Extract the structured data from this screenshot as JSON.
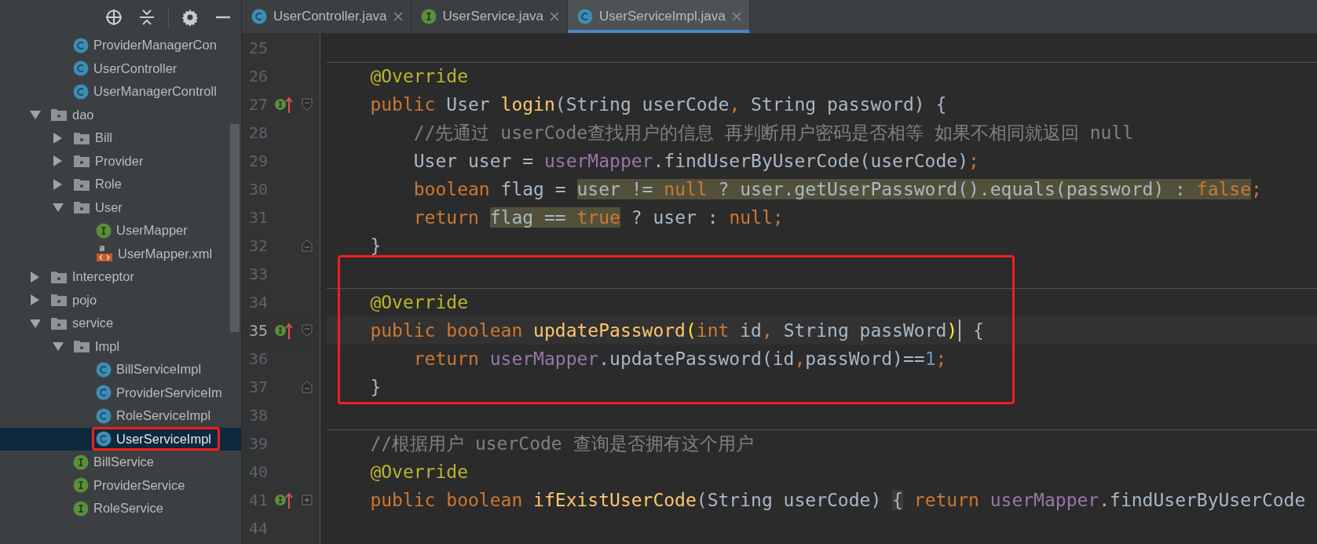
{
  "toolbar": {
    "buttons": [
      {
        "kind": "locate"
      },
      {
        "kind": "collapse"
      },
      {
        "kind": "settings"
      },
      {
        "kind": "hide"
      }
    ]
  },
  "tabs": [
    {
      "label": "UserController.java",
      "kind": "class",
      "selected": false
    },
    {
      "label": "UserService.java",
      "kind": "interface",
      "selected": false
    },
    {
      "label": "UserServiceImpl.java",
      "kind": "class",
      "selected": true
    }
  ],
  "sidebar": {
    "items": [
      {
        "children": [
          {
            "label": "ProviderManagerCon",
            "kind": "class"
          },
          {
            "label": "UserController",
            "kind": "class"
          },
          {
            "label": "UserManagerControll",
            "kind": "class"
          }
        ]
      },
      {
        "label": "dao",
        "kind": "folder",
        "expanded": true,
        "children": [
          {
            "label": "Bill",
            "kind": "folder",
            "expanded": false
          },
          {
            "label": "Provider",
            "kind": "folder",
            "expanded": false
          },
          {
            "label": "Role",
            "kind": "folder",
            "expanded": false
          },
          {
            "label": "User",
            "kind": "folder",
            "expanded": true,
            "children": [
              {
                "label": "UserMapper",
                "kind": "interface"
              },
              {
                "label": "UserMapper.xml",
                "kind": "xml"
              }
            ]
          }
        ]
      },
      {
        "label": "Interceptor",
        "kind": "folder",
        "expanded": false
      },
      {
        "label": "pojo",
        "kind": "folder",
        "expanded": false
      },
      {
        "label": "service",
        "kind": "folder",
        "expanded": true,
        "children": [
          {
            "label": "Impl",
            "kind": "folder",
            "expanded": true,
            "children": [
              {
                "label": "BillServiceImpl",
                "kind": "class",
                "selected": false,
                "boxed": false
              },
              {
                "label": "ProviderServiceIm",
                "kind": "class",
                "selected": false,
                "boxed": false
              },
              {
                "label": "RoleServiceImpl",
                "kind": "class",
                "selected": false,
                "boxed": false
              },
              {
                "label": "UserServiceImpl",
                "kind": "class",
                "selected": true,
                "boxed": true
              }
            ]
          },
          {
            "label": "BillService",
            "kind": "interface"
          },
          {
            "label": "ProviderService",
            "kind": "interface"
          },
          {
            "label": "RoleService",
            "kind": "interface"
          }
        ]
      }
    ]
  },
  "editor": {
    "lines": [
      {
        "number": "25"
      },
      {
        "number": "26",
        "separator_above": true,
        "tokens": [
          {
            "text": "    @Override",
            "kind": "annotation"
          }
        ]
      },
      {
        "number": "27",
        "marker": true,
        "fold_start": true,
        "tokens": [
          {
            "text": "    public",
            "kind": "keyword"
          },
          {
            "text": " User ",
            "kind": "plain"
          },
          {
            "text": "login",
            "kind": "method"
          },
          {
            "text": "(String userCode",
            "kind": "plain"
          },
          {
            "text": ",",
            "kind": "keyword"
          },
          {
            "text": " String password) {",
            "kind": "plain"
          }
        ]
      },
      {
        "number": "28",
        "tokens": [
          {
            "text": "        //先通过 userCode查找用户的信息 再判断用户密码是否相等 如果不相同就返回 null",
            "kind": "comment"
          }
        ]
      },
      {
        "number": "29",
        "tokens": [
          {
            "text": "        User user = ",
            "kind": "plain"
          },
          {
            "text": "userMapper",
            "kind": "field"
          },
          {
            "text": ".findUserByUserCode(userCode)",
            "kind": "plain"
          },
          {
            "text": ";",
            "kind": "keyword"
          }
        ]
      },
      {
        "number": "30",
        "tokens": [
          {
            "text": "        boolean",
            "kind": "keyword"
          },
          {
            "text": " flag = ",
            "kind": "plain"
          },
          {
            "text": "user != ",
            "kind": "plain",
            "highlighted": true
          },
          {
            "text": "null",
            "kind": "keyword",
            "highlighted": true
          },
          {
            "text": " ? user.getUserPassword().equals(password) : ",
            "kind": "plain",
            "highlighted": true
          },
          {
            "text": "false",
            "kind": "keyword",
            "highlighted": true
          },
          {
            "text": ";",
            "kind": "keyword"
          }
        ]
      },
      {
        "number": "31",
        "tokens": [
          {
            "text": "        return ",
            "kind": "keyword"
          },
          {
            "text": "flag == ",
            "kind": "plain",
            "highlighted": true
          },
          {
            "text": "true",
            "kind": "keyword",
            "highlighted": true
          },
          {
            "text": " ? user : ",
            "kind": "plain"
          },
          {
            "text": "null;",
            "kind": "keyword"
          }
        ]
      },
      {
        "number": "32",
        "fold_end": true,
        "tokens": [
          {
            "text": "    }",
            "kind": "plain"
          }
        ]
      },
      {
        "number": "33",
        "boxed": true
      },
      {
        "number": "34",
        "boxed": true,
        "separator_above": true,
        "tokens": [
          {
            "text": "    @Override",
            "kind": "annotation"
          }
        ]
      },
      {
        "number": "35",
        "boxed": true,
        "current": true,
        "marker": true,
        "fold_start": true,
        "tokens": [
          {
            "text": "    public boolean ",
            "kind": "keyword"
          },
          {
            "text": "updatePassword",
            "kind": "method"
          },
          {
            "text": "(",
            "kind": "brace-match"
          },
          {
            "text": "int",
            "kind": "keyword"
          },
          {
            "text": " id",
            "kind": "plain"
          },
          {
            "text": ",",
            "kind": "keyword"
          },
          {
            "text": " String passWord",
            "kind": "plain"
          },
          {
            "text": ")",
            "kind": "brace-match"
          },
          {
            "kind": "caret"
          },
          {
            "text": " {",
            "kind": "plain"
          }
        ]
      },
      {
        "number": "36",
        "boxed": true,
        "tokens": [
          {
            "text": "        return ",
            "kind": "keyword"
          },
          {
            "text": "userMapper",
            "kind": "field"
          },
          {
            "text": ".updatePassword(id",
            "kind": "plain"
          },
          {
            "text": ",",
            "kind": "keyword"
          },
          {
            "text": "passWord)==",
            "kind": "plain"
          },
          {
            "text": "1",
            "kind": "number"
          },
          {
            "text": ";",
            "kind": "keyword"
          }
        ]
      },
      {
        "number": "37",
        "boxed": true,
        "fold_end": true,
        "tokens": [
          {
            "text": "    }",
            "kind": "plain"
          }
        ]
      },
      {
        "number": "38"
      },
      {
        "number": "39",
        "separator_above": true,
        "tokens": [
          {
            "text": "    //根据用户 userCode 查询是否拥有这个用户",
            "kind": "comment"
          }
        ]
      },
      {
        "number": "40",
        "tokens": [
          {
            "text": "    @Override",
            "kind": "annotation"
          }
        ]
      },
      {
        "number": "41",
        "marker": true,
        "folded": true,
        "tokens": [
          {
            "text": "    public boolean ",
            "kind": "keyword"
          },
          {
            "text": "ifExistUserCode",
            "kind": "method"
          },
          {
            "text": "(String userCode) ",
            "kind": "plain"
          },
          {
            "text": "{",
            "kind": "folded-brace"
          },
          {
            "text": " return ",
            "kind": "keyword"
          },
          {
            "text": "userMapper",
            "kind": "field"
          },
          {
            "text": ".findUserByUserCode",
            "kind": "plain"
          }
        ]
      },
      {
        "number": "44"
      }
    ]
  }
}
